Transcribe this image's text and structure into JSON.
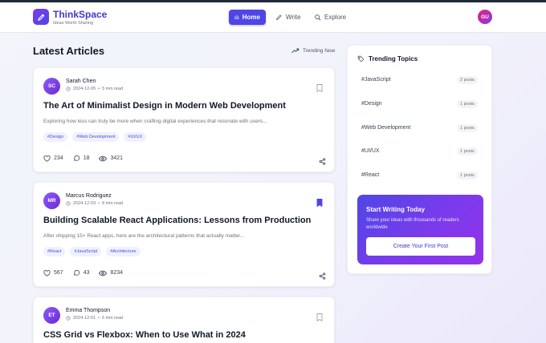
{
  "brand": {
    "title": "ThinkSpace",
    "tagline": "Ideas Worth Sharing"
  },
  "nav": {
    "home": "Home",
    "write": "Write",
    "explore": "Explore"
  },
  "user": {
    "initials": "GU"
  },
  "main": {
    "section_title": "Latest Articles",
    "trending_now": "Trending Now"
  },
  "articles": [
    {
      "initials": "SC",
      "author": "Sarah Chen",
      "date": "2024-12-05",
      "read_time": "5 min read",
      "title": "The Art of Minimalist Design in Modern Web Development",
      "excerpt": "Exploring how less can truly be more when crafting digital experiences that resonate with users...",
      "tags": [
        "#Design",
        "#Web Development",
        "#UI/UX"
      ],
      "likes": "234",
      "comments": "18",
      "views": "3421",
      "bookmarked": false
    },
    {
      "initials": "MR",
      "author": "Marcus Rodriguez",
      "date": "2024-12-03",
      "read_time": "8 min read",
      "title": "Building Scalable React Applications: Lessons from Production",
      "excerpt": "After shipping 15+ React apps, here are the architectural patterns that actually matter...",
      "tags": [
        "#React",
        "#JavaScript",
        "#Architecture"
      ],
      "likes": "567",
      "comments": "43",
      "views": "8234",
      "bookmarked": true
    },
    {
      "initials": "ET",
      "author": "Emma Thompson",
      "date": "2024-12-01",
      "read_time": "6 min read",
      "title": "CSS Grid vs Flexbox: When to Use What in 2024",
      "bookmarked": false
    }
  ],
  "sidebar": {
    "title": "Trending Topics",
    "topics": [
      {
        "name": "#JavaScript",
        "count": "2 posts"
      },
      {
        "name": "#Design",
        "count": "1 posts"
      },
      {
        "name": "#Web Development",
        "count": "1 posts"
      },
      {
        "name": "#UI/UX",
        "count": "1 posts"
      },
      {
        "name": "#React",
        "count": "1 posts"
      }
    ],
    "cta": {
      "title": "Start Writing Today",
      "description": "Share your ideas with thousands of readers worldwide",
      "button": "Create Your First Post"
    }
  },
  "colors": {
    "accent": "#4f46e5",
    "brand_text": "#4338ca",
    "cta_start": "#4f46e5",
    "cta_end": "#9333ea"
  }
}
